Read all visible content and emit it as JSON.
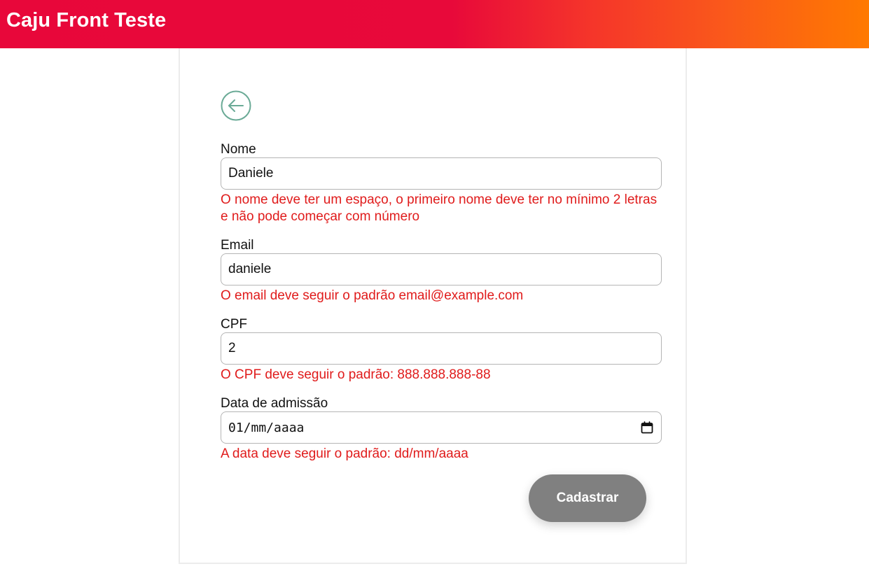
{
  "header": {
    "title": "Caju Front Teste",
    "gradient_colors": [
      "#e8073a",
      "#ff7a00"
    ]
  },
  "form": {
    "back_icon": "arrow-left-circle-icon",
    "fields": {
      "nome": {
        "label": "Nome",
        "value": "Daniele",
        "error": "O nome deve ter um espaço, o primeiro nome deve ter no mínimo 2 letras e não pode começar com número"
      },
      "email": {
        "label": "Email",
        "value": "daniele",
        "error": "O email deve seguir o padrão email@example.com"
      },
      "cpf": {
        "label": "CPF",
        "value": "2",
        "error": "O CPF deve seguir o padrão: 888.888.888-88"
      },
      "admission_date": {
        "label": "Data de admissão",
        "value": "01/mm/aaaa",
        "icon": "calendar-icon",
        "error": "A data deve seguir o padrão: dd/mm/aaaa"
      }
    },
    "submit_label": "Cadastrar",
    "colors": {
      "error": "#e01b1b",
      "back_icon": "#6aaa96",
      "submit_bg": "#808080"
    }
  }
}
